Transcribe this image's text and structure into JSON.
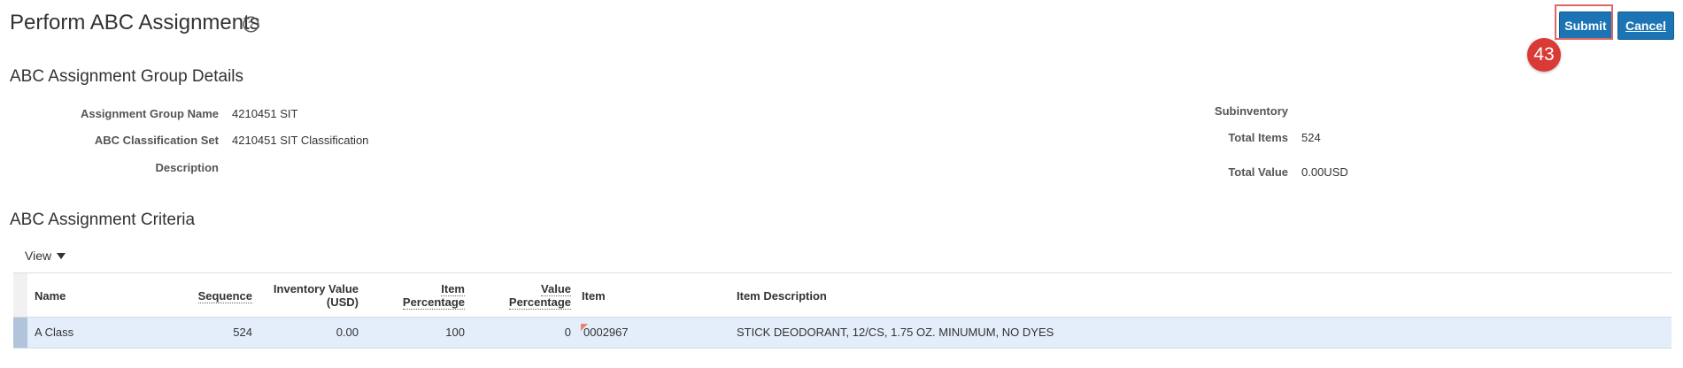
{
  "header": {
    "title": "Perform ABC Assignments",
    "submit_label": "Submit",
    "cancel_label": "Cancel",
    "step_badge": "43"
  },
  "group_details": {
    "section_title": "ABC Assignment Group Details",
    "fields": {
      "assignment_group_name": {
        "label": "Assignment Group Name",
        "value": "4210451 SIT"
      },
      "classification_set": {
        "label": "ABC Classification Set",
        "value": "4210451 SIT Classification"
      },
      "description": {
        "label": "Description",
        "value": ""
      },
      "subinventory": {
        "label": "Subinventory",
        "value": ""
      },
      "total_items": {
        "label": "Total Items",
        "value": "524"
      },
      "total_value": {
        "label": "Total Value",
        "value": "0.00USD"
      }
    }
  },
  "criteria": {
    "section_title": "ABC Assignment Criteria",
    "view_menu_label": "View",
    "columns": {
      "name": "Name",
      "sequence": "Sequence",
      "inventory_value_line1": "Inventory Value",
      "inventory_value_line2": "(USD)",
      "item_pct_line1": "Item",
      "item_pct_line2": "Percentage",
      "value_pct_line1": "Value",
      "value_pct_line2": "Percentage",
      "item": "Item",
      "item_description": "Item Description"
    },
    "rows": [
      {
        "name": "A Class",
        "sequence": "524",
        "inventory_value": "0.00",
        "item_percentage": "100",
        "value_percentage": "0",
        "item": "0002967",
        "item_description": "STICK DEODORANT, 12/CS, 1.75 OZ. MINUMUM, NO DYES"
      }
    ]
  },
  "colors": {
    "button_blue": "#1c74b5",
    "badge_red": "#d93a35",
    "selected_row": "#e3eefa"
  }
}
